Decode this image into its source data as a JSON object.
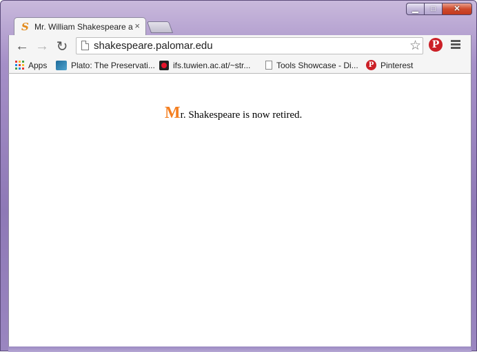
{
  "browser": {
    "tab": {
      "title": "Mr. William Shakespeare a",
      "favicon": "S",
      "close_glyph": "×"
    },
    "window_controls": {
      "minimize_glyph": "▁",
      "maximize_glyph": "□",
      "close_glyph": "✕"
    },
    "toolbar": {
      "back_glyph": "←",
      "forward_glyph": "→",
      "reload_glyph": "↻",
      "url": "shakespeare.palomar.edu",
      "star_glyph": "☆",
      "pinterest_glyph": "P"
    },
    "bookmarks": [
      {
        "label": "Apps",
        "icon": "apps-grid-icon"
      },
      {
        "label": "Plato: The Preservati...",
        "icon": "plato-icon"
      },
      {
        "label": "ifs.tuwien.ac.at/~str...",
        "icon": "record-icon"
      },
      {
        "label": "Tools Showcase - Di...",
        "icon": "page-icon"
      },
      {
        "label": "Pinterest",
        "icon": "pinterest-icon"
      }
    ],
    "pinterest_small_glyph": "P"
  },
  "page": {
    "dropcap": "M",
    "message_rest": "r.  Shakespeare is now retired."
  },
  "colors": {
    "dropcap": "#f47f20",
    "pinterest": "#cb2027"
  }
}
